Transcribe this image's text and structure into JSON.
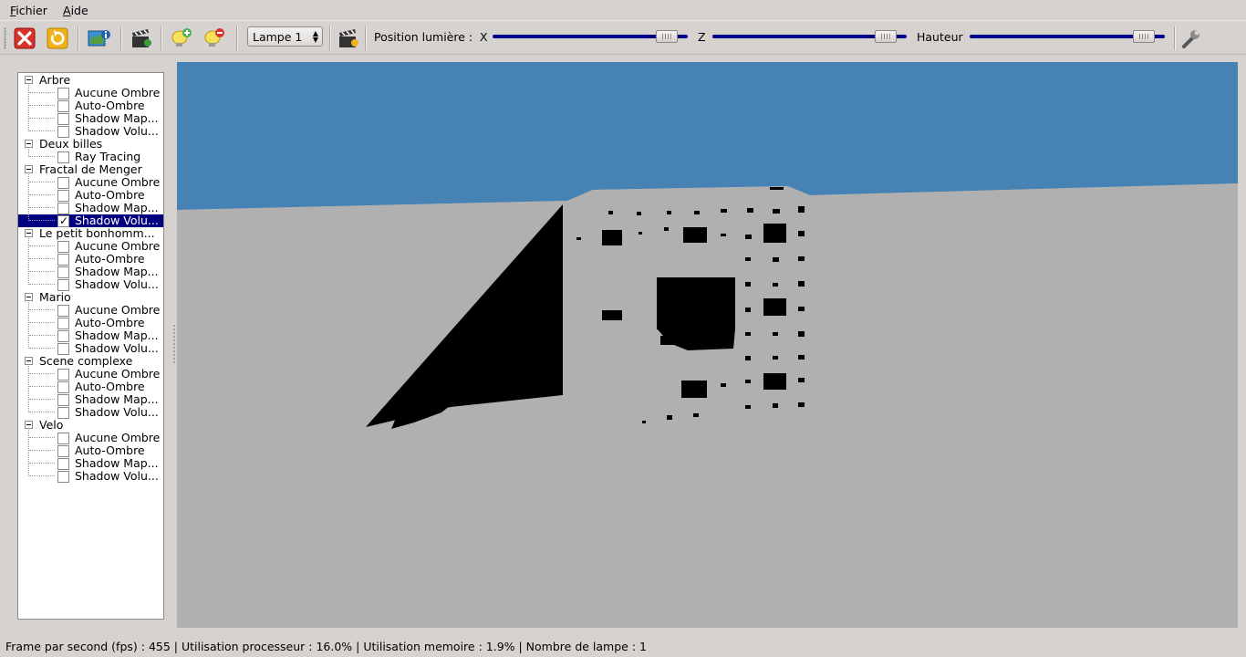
{
  "menubar": {
    "items": [
      {
        "mnemonic": "F",
        "rest": "ichier"
      },
      {
        "mnemonic": "A",
        "rest": "ide"
      }
    ]
  },
  "toolbar": {
    "lamp_select_value": "Lampe 1",
    "light_position_label": "Position lumière :",
    "x_label": "X",
    "z_label": "Z",
    "height_label": "Hauteur",
    "slider_x_value": 0.94,
    "slider_z_value": 0.94,
    "slider_height_value": 0.94,
    "accent_color": "#00008b"
  },
  "tree": {
    "groups": [
      {
        "label": "Arbre",
        "children": [
          {
            "label": "Aucune Ombre",
            "checked": false
          },
          {
            "label": "Auto-Ombre",
            "checked": false
          },
          {
            "label": "Shadow Map...",
            "checked": false
          },
          {
            "label": "Shadow Volu...",
            "checked": false
          }
        ]
      },
      {
        "label": "Deux billes",
        "children": [
          {
            "label": "Ray Tracing",
            "checked": false
          }
        ]
      },
      {
        "label": "Fractal de Menger",
        "children": [
          {
            "label": "Aucune Ombre",
            "checked": false
          },
          {
            "label": "Auto-Ombre",
            "checked": false
          },
          {
            "label": "Shadow Map...",
            "checked": false
          },
          {
            "label": "Shadow Volu...",
            "checked": true,
            "selected": true
          }
        ]
      },
      {
        "label": "Le petit bonhomm...",
        "children": [
          {
            "label": "Aucune Ombre",
            "checked": false
          },
          {
            "label": "Auto-Ombre",
            "checked": false
          },
          {
            "label": "Shadow Map...",
            "checked": false
          },
          {
            "label": "Shadow Volu...",
            "checked": false
          }
        ]
      },
      {
        "label": "Mario",
        "children": [
          {
            "label": "Aucune Ombre",
            "checked": false
          },
          {
            "label": "Auto-Ombre",
            "checked": false
          },
          {
            "label": "Shadow Map...",
            "checked": false
          },
          {
            "label": "Shadow Volu...",
            "checked": false
          }
        ]
      },
      {
        "label": "Scene complexe",
        "children": [
          {
            "label": "Aucune Ombre",
            "checked": false
          },
          {
            "label": "Auto-Ombre",
            "checked": false
          },
          {
            "label": "Shadow Map...",
            "checked": false
          },
          {
            "label": "Shadow Volu...",
            "checked": false
          }
        ]
      },
      {
        "label": "Velo",
        "children": [
          {
            "label": "Aucune Ombre",
            "checked": false
          },
          {
            "label": "Auto-Ombre",
            "checked": false
          },
          {
            "label": "Shadow Map...",
            "checked": false
          },
          {
            "label": "Shadow Volu...",
            "checked": false
          }
        ]
      }
    ],
    "selection_color": "#000080"
  },
  "viewport": {
    "sky_color": "#4682b4",
    "ground_color": "#b0b0b0",
    "shadow_color": "#000000"
  },
  "status": {
    "text": "Frame par second (fps) : 455  |  Utilisation processeur : 16.0%  |  Utilisation memoire : 1.9%  |  Nombre de lampe : 1"
  },
  "icons": [
    "close-scene-icon",
    "reload-icon",
    "scene-info-icon",
    "render-clapper-icon",
    "add-light-icon",
    "remove-light-icon",
    "light-clapper-icon",
    "settings-wrench-icon",
    "checkbox-check-icon",
    "tree-collapse-icon"
  ]
}
